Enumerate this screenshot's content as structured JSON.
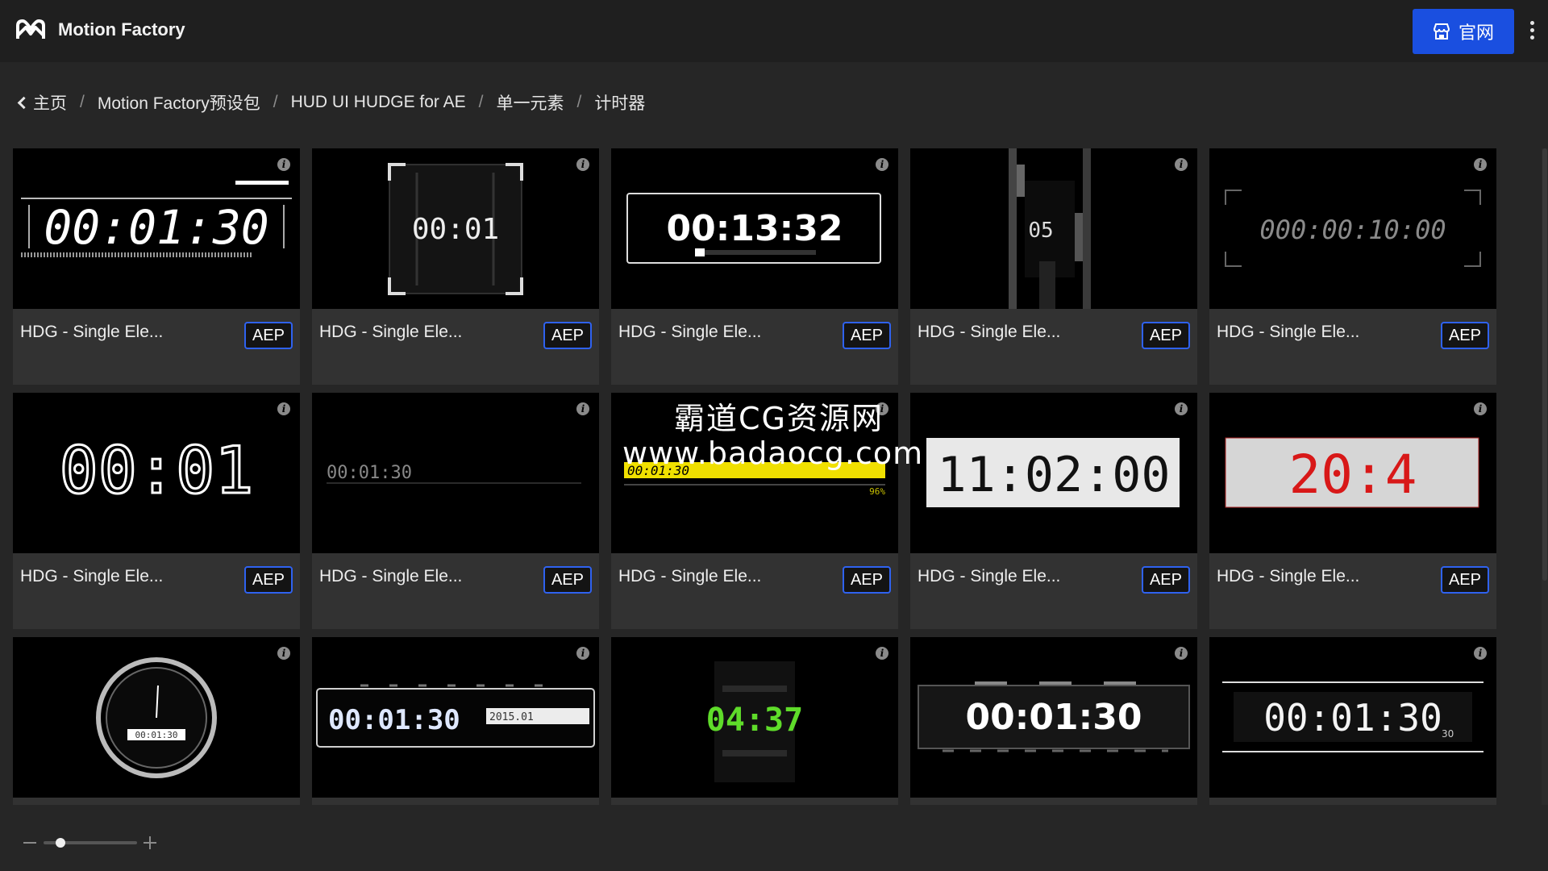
{
  "header": {
    "app_title": "Motion Factory",
    "site_button_label": "官网",
    "accent_color": "#1a4fe0"
  },
  "breadcrumb": {
    "items": [
      "主页",
      "Motion Factory预设包",
      "HUD UI HUDGE for AE",
      "单一元素",
      "计时器"
    ],
    "separator": "/"
  },
  "cards": [
    {
      "title": "HDG - Single Ele...",
      "badge": "AEP",
      "preview_text": "00:01:30"
    },
    {
      "title": "HDG - Single Ele...",
      "badge": "AEP",
      "preview_text": "00:01"
    },
    {
      "title": "HDG - Single Ele...",
      "badge": "AEP",
      "preview_text": "00:13:32"
    },
    {
      "title": "HDG - Single Ele...",
      "badge": "AEP",
      "preview_text": "05"
    },
    {
      "title": "HDG - Single Ele...",
      "badge": "AEP",
      "preview_text": "000:00:10:00"
    },
    {
      "title": "HDG - Single Ele...",
      "badge": "AEP",
      "preview_text": "00:01"
    },
    {
      "title": "HDG - Single Ele...",
      "badge": "AEP",
      "preview_text": "00:01:30"
    },
    {
      "title": "HDG - Single Ele...",
      "badge": "AEP",
      "preview_text": "00:01:30",
      "preview_sub": "96%"
    },
    {
      "title": "HDG - Single Ele...",
      "badge": "AEP",
      "preview_text": "11:02:00"
    },
    {
      "title": "HDG - Single Ele...",
      "badge": "AEP",
      "preview_text": "20:4"
    },
    {
      "title": "",
      "badge": "",
      "preview_text": "00:01:30"
    },
    {
      "title": "",
      "badge": "",
      "preview_text": "00:01:30",
      "preview_sub": "2015.01"
    },
    {
      "title": "",
      "badge": "",
      "preview_text": "04:37"
    },
    {
      "title": "",
      "badge": "",
      "preview_text": "00:01:30"
    },
    {
      "title": "",
      "badge": "",
      "preview_text": "00:01:30",
      "preview_sub": "30"
    }
  ],
  "icons": {
    "logo": "motion-factory-logo-icon",
    "site": "store-icon",
    "more": "kebab-menu-icon",
    "back": "chevron-left-icon",
    "info": "info-icon"
  },
  "zoom": {
    "value": 0.18
  },
  "watermark": {
    "line1": "霸道CG资源网",
    "line2": "www.badaocg.com"
  }
}
